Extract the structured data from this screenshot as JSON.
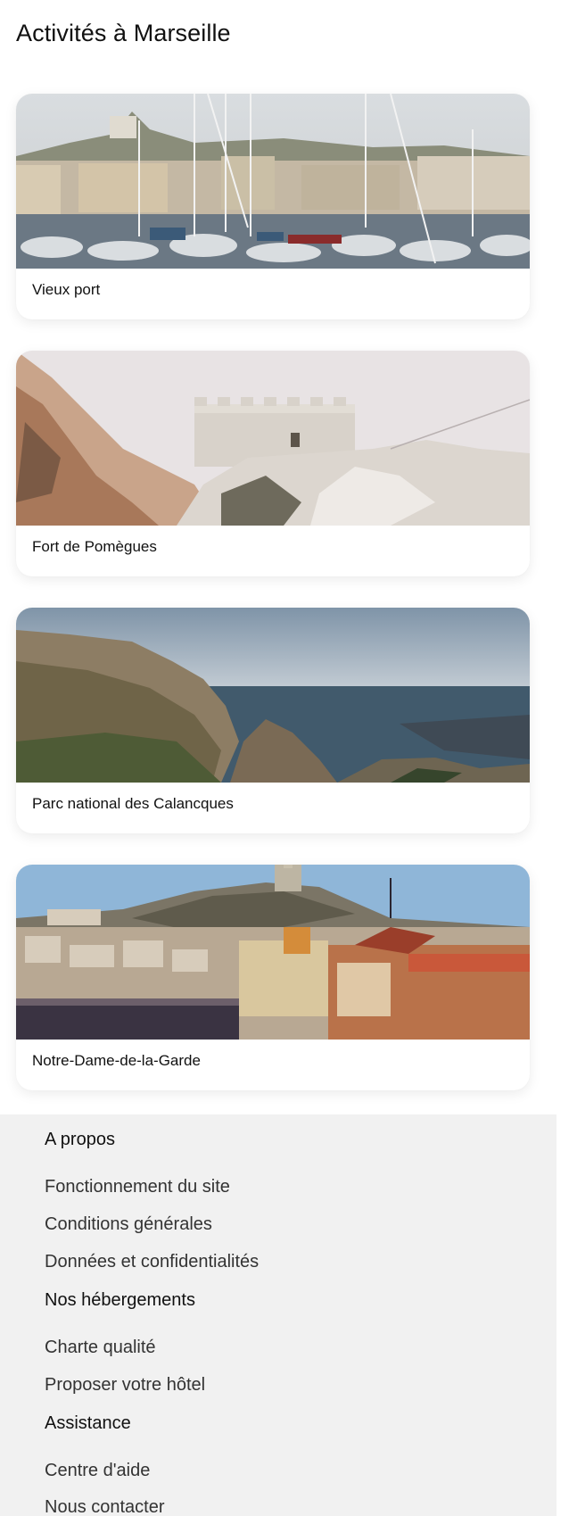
{
  "page": {
    "title": "Activités à Marseille"
  },
  "cards": [
    {
      "label": "Vieux port",
      "image": "harbor-boats-photo"
    },
    {
      "label": "Fort de Pomègues",
      "image": "stone-fort-photo"
    },
    {
      "label": "Parc national des Calancques",
      "image": "coastal-cliffs-photo"
    },
    {
      "label": "Notre-Dame-de-la-Garde",
      "image": "city-rooftops-photo"
    }
  ],
  "footer": {
    "about": {
      "heading": "A propos",
      "links": [
        "Fonctionnement du site",
        "Conditions générales",
        "Données et confidentialités"
      ]
    },
    "lodging": {
      "heading": "Nos hébergements",
      "links": [
        "Charte qualité",
        "Proposer votre hôtel"
      ]
    },
    "help": {
      "heading": "Assistance",
      "links": [
        "Centre d'aide",
        "Nous contacter"
      ]
    }
  }
}
